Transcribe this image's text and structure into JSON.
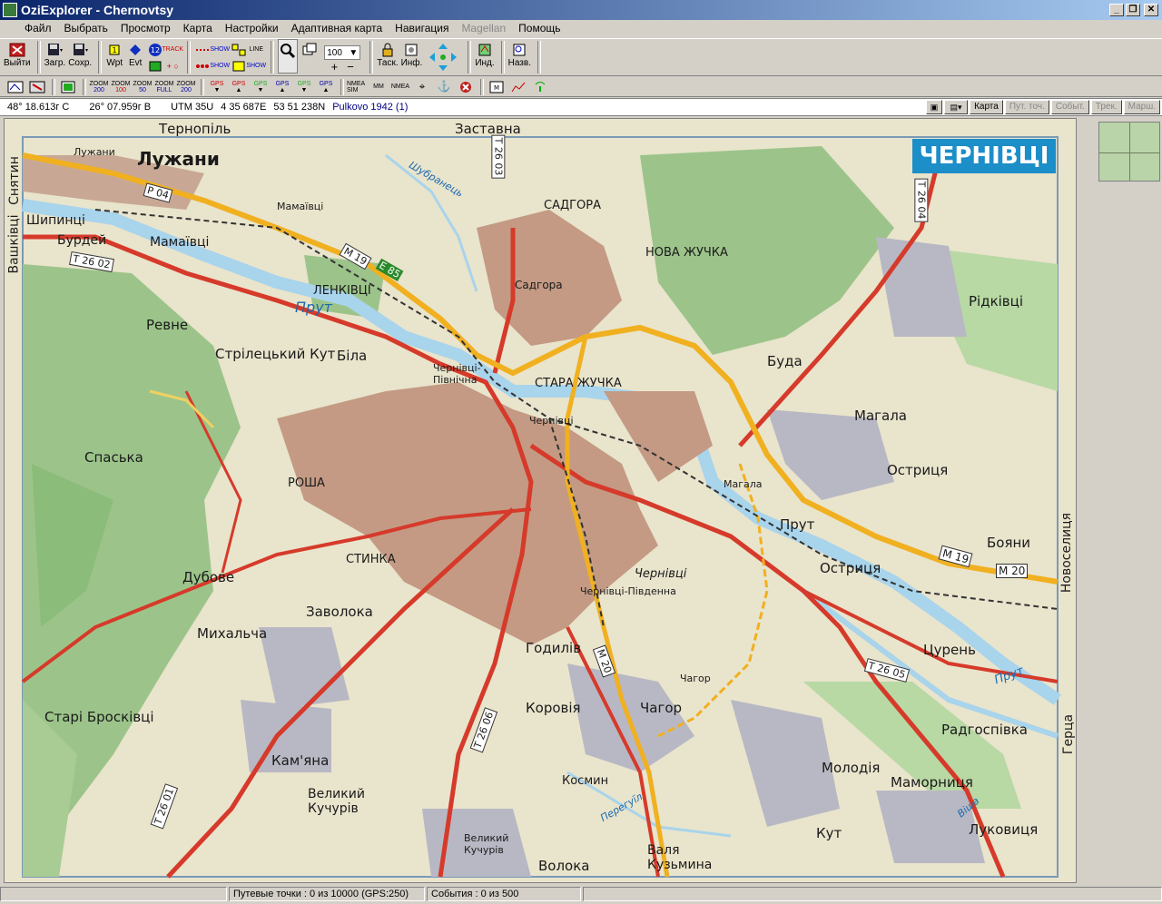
{
  "window": {
    "title": "OziExplorer - Chernovtsy",
    "controls": [
      "_",
      "❐",
      "✕"
    ]
  },
  "menu": [
    {
      "label": "Файл",
      "enabled": true
    },
    {
      "label": "Выбрать",
      "enabled": true
    },
    {
      "label": "Просмотр",
      "enabled": true
    },
    {
      "label": "Карта",
      "enabled": true
    },
    {
      "label": "Настройки",
      "enabled": true
    },
    {
      "label": "Адаптивная карта",
      "enabled": true
    },
    {
      "label": "Навигация",
      "enabled": true
    },
    {
      "label": "Magellan",
      "enabled": false
    },
    {
      "label": "Помощь",
      "enabled": true
    }
  ],
  "toolbar": {
    "exit": "Выйти",
    "load": "Загр.",
    "save": "Сохр.",
    "wpt": "Wpt",
    "evt": "Evt",
    "wpt_count": "12",
    "track": "TRACK",
    "show": "SHOW",
    "zoom_value": "100",
    "task": "Таск.",
    "info": "Инф.",
    "ind": "Инд.",
    "names": "Назв."
  },
  "toolbar2": {
    "zoom_items": [
      {
        "top": "ZOOM",
        "bottom": "200"
      },
      {
        "top": "ZOOM",
        "bottom": "100"
      },
      {
        "top": "ZOOM",
        "bottom": "50"
      },
      {
        "top": "ZOOM",
        "bottom": "FULL"
      },
      {
        "top": "ZOOM",
        "bottom": "200"
      }
    ],
    "gps_items": [
      "GPS",
      "GPS",
      "GPS",
      "GPS",
      "GPS",
      "GPS"
    ],
    "nmea_sim": "NMEA SIM",
    "mm": "MM",
    "nmea": "NMEA"
  },
  "status": {
    "lat": "48° 18.613г С",
    "lon": "26° 07.959г В",
    "utm_zone": "UTM  35U",
    "easting": "4 35 687E",
    "northing": "53 51 238N",
    "datum": "Pulkovo 1942 (1)",
    "buttons": [
      {
        "label": "Карта",
        "enabled": true
      },
      {
        "label": "Пут. точ.",
        "enabled": false
      },
      {
        "label": "Событ.",
        "enabled": false
      },
      {
        "label": "Трек.",
        "enabled": false
      },
      {
        "label": "Марш.",
        "enabled": false
      }
    ]
  },
  "bottom": {
    "waypoints": "Путевые точки : 0 из 10000  (GPS:250)",
    "events": "События : 0 из 500"
  },
  "map": {
    "header": "ЧЕРНІВЦІ",
    "edge_labels": {
      "top_left": "Тернопіль",
      "top_mid": "Заставна",
      "left_top": "Снятин",
      "left_mid": "Вашківці",
      "right_mid": "Новоселиця",
      "right_bottom": "Герца"
    },
    "places": [
      {
        "name": "Лужани"
      },
      {
        "name": "Лужани"
      },
      {
        "name": "Мамаївці"
      },
      {
        "name": "Мамаївці"
      },
      {
        "name": "Шипинці"
      },
      {
        "name": "Бурдей"
      },
      {
        "name": "Ревне"
      },
      {
        "name": "Стрілецький Кут"
      },
      {
        "name": "ЛЕНКІВЦІ"
      },
      {
        "name": "Біла"
      },
      {
        "name": "Чернівці-Північна"
      },
      {
        "name": "Прут"
      },
      {
        "name": "САДГОРА"
      },
      {
        "name": "Садгора"
      },
      {
        "name": "НОВА ЖУЧКА"
      },
      {
        "name": "СТАРА ЖУЧКА"
      },
      {
        "name": "Чернівці"
      },
      {
        "name": "Рідківці"
      },
      {
        "name": "Буда"
      },
      {
        "name": "Магала"
      },
      {
        "name": "Магала"
      },
      {
        "name": "Остриця"
      },
      {
        "name": "Остриця"
      },
      {
        "name": "Прут"
      },
      {
        "name": "Бояни"
      },
      {
        "name": "Спаська"
      },
      {
        "name": "РОША"
      },
      {
        "name": "СТИНКА"
      },
      {
        "name": "Дубове"
      },
      {
        "name": "Заволока"
      },
      {
        "name": "Михальча"
      },
      {
        "name": "Чернівці"
      },
      {
        "name": "Чернівці-Південна"
      },
      {
        "name": "Годилів"
      },
      {
        "name": "Коровія"
      },
      {
        "name": "Чагор"
      },
      {
        "name": "Чагор"
      },
      {
        "name": "Старі Броскiвці"
      },
      {
        "name": "Кам'яна"
      },
      {
        "name": "Великий Кучурів"
      },
      {
        "name": "Космин"
      },
      {
        "name": "Молодія"
      },
      {
        "name": "Маморниця"
      },
      {
        "name": "Радгоспівка"
      },
      {
        "name": "Цурень"
      },
      {
        "name": "Кут"
      },
      {
        "name": "Луковиця"
      },
      {
        "name": "Валя Кузьмина"
      },
      {
        "name": "Волока"
      },
      {
        "name": "Великий Кучурів"
      },
      {
        "name": "Шубранець"
      },
      {
        "name": "Прут"
      },
      {
        "name": "Перегуїл"
      },
      {
        "name": "Віша"
      }
    ],
    "road_labels": [
      "Р 04",
      "М 19",
      "Е 85",
      "Т 26 02",
      "Т 26 03",
      "Т 26 04",
      "М 19",
      "М 20",
      "Т 26 05",
      "М 20",
      "Т 26 06",
      "Т 26 01"
    ]
  },
  "colors": {
    "titlebar_start": "#0a246a",
    "titlebar_end": "#a6caf0",
    "map_bg": "#e9e4cc",
    "forest": "#9cc48a",
    "city": "#c49a84",
    "river": "#a8d4ec",
    "road_main": "#d63a2a",
    "road_yellow": "#f0b020",
    "header": "#1c8ec8"
  }
}
